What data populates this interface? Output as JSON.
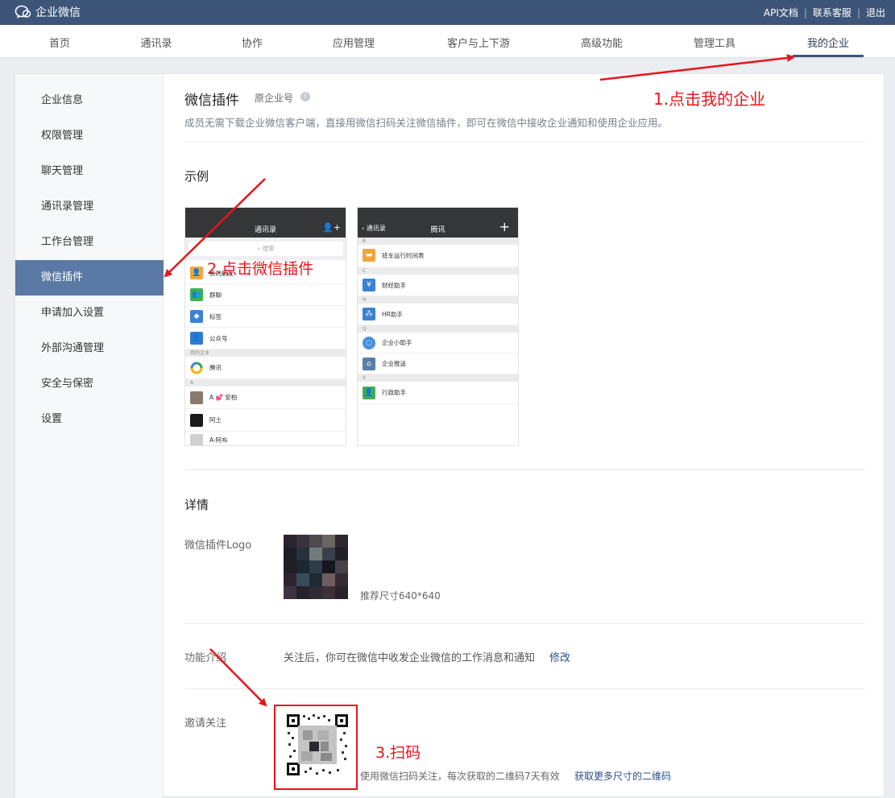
{
  "topbar": {
    "brand": "企业微信",
    "links": [
      "API文档",
      "联系客服",
      "退出"
    ]
  },
  "nav": {
    "tabs": [
      "首页",
      "通讯录",
      "协作",
      "应用管理",
      "客户与上下游",
      "高级功能",
      "管理工具",
      "我的企业"
    ],
    "active": "我的企业"
  },
  "sidebar": {
    "items": [
      "企业信息",
      "权限管理",
      "聊天管理",
      "通讯录管理",
      "工作台管理",
      "微信插件",
      "申请加入设置",
      "外部沟通管理",
      "安全与保密",
      "设置"
    ],
    "active": "微信插件"
  },
  "main": {
    "title": "微信插件",
    "title_sub": "原企业号",
    "desc": "成员无需下载企业微信客户端，直接用微信扫码关注微信插件，即可在微信中接收企业通知和使用企业应用。",
    "example_heading": "示例",
    "phone1": {
      "title": "通讯录",
      "search": "搜索",
      "rows": [
        "新的朋友",
        "群聊",
        "标签",
        "公众号"
      ],
      "group1": "我的企业",
      "company": "腾讯",
      "group2": "A",
      "contacts": [
        "A 💕 安柏",
        "阿土",
        "A-阿布"
      ]
    },
    "phone2": {
      "back": "通讯录",
      "title": "腾讯",
      "plus": "+",
      "groups": [
        "B",
        "C",
        "H",
        "Q",
        "X"
      ],
      "apps": [
        "班车运行时间表",
        "财经助手",
        "HR助手",
        "企业小助手",
        "企业推送",
        "行政助手"
      ]
    },
    "details_heading": "详情",
    "logo_label": "微信插件Logo",
    "logo_hint": "推荐尺寸640*640",
    "intro_label": "功能介绍",
    "intro_text": "关注后，你可在微信中收发企业微信的工作消息和通知",
    "intro_edit": "修改",
    "invite_label": "邀请关注",
    "invite_text": "使用微信扫码关注，每次获取的二维码7天有效",
    "invite_link": "获取更多尺寸的二维码"
  },
  "annotations": {
    "step1": "1.点击我的企业",
    "step2": "2.点击微信插件",
    "step3": "3.扫码"
  },
  "colors": {
    "topbar": "#3d5578",
    "active_side": "#5a79a4",
    "annotation": "#e8141b",
    "link": "#2a4f8a"
  }
}
